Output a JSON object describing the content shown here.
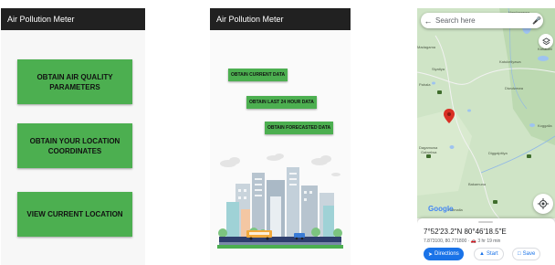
{
  "screen1": {
    "title": "Air Pollution Meter",
    "buttons": [
      {
        "label": "OBTAIN AIR QUALITY PARAMETERS"
      },
      {
        "label": "OBTAIN YOUR LOCATION COORDINATES"
      },
      {
        "label": "VIEW CURRENT LOCATION"
      }
    ]
  },
  "screen2": {
    "title": "Air Pollution Meter",
    "buttons": [
      {
        "label": "OBTAIN CURRENT DATA"
      },
      {
        "label": "OBTAIN LAST 24 HOUR DATA"
      },
      {
        "label": "OBTAIN FORECASTED DATA"
      }
    ]
  },
  "screen3": {
    "search": {
      "placeholder": "Search here"
    },
    "map_labels": [
      "Hambawewa",
      "Madagama",
      "Kahatahi",
      "Katukeliyawa",
      "Siyatiya",
      "Diwulwewa",
      "Pahala",
      "Koggalla",
      "Dagamuwa",
      "Galwelwa",
      "Diggalpitiya",
      "Bakamuna",
      "Ratmalla"
    ],
    "google_logo": "Google",
    "coordinates": "7°52'23.2\"N 80°46'18.5\"E",
    "subtitle": "7.873100, 80.771800 · 🚗 3 hr 19 min",
    "actions": [
      {
        "label": "Directions"
      },
      {
        "label": "Start"
      },
      {
        "label": "Save"
      }
    ],
    "colors": {
      "map_base": "#cfe4c6",
      "water": "#9ec3f0",
      "pin": "#d93025",
      "accent": "#1a73e8"
    }
  },
  "colors": {
    "app_bar": "#212121",
    "button_green": "#4caf50"
  }
}
